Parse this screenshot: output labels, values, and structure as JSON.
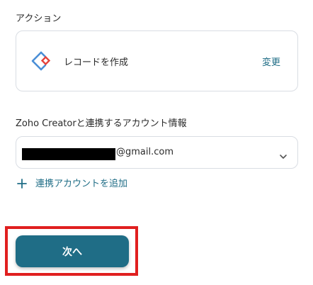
{
  "action_section": {
    "label": "アクション",
    "card": {
      "app_icon": "zoho-creator-icon",
      "action_name": "レコードを作成",
      "change_label": "変更"
    }
  },
  "account_section": {
    "label": "Zoho Creatorと連携するアカウント情報",
    "selected_account": "@gmail.com",
    "dropdown_icon": "chevron-down-icon",
    "add_account_label": "連携アカウントを追加",
    "add_icon": "plus-icon"
  },
  "footer": {
    "next_label": "次へ"
  },
  "colors": {
    "accent": "#1f6d86",
    "highlight": "#e01f1f",
    "border": "#d9dde3"
  }
}
